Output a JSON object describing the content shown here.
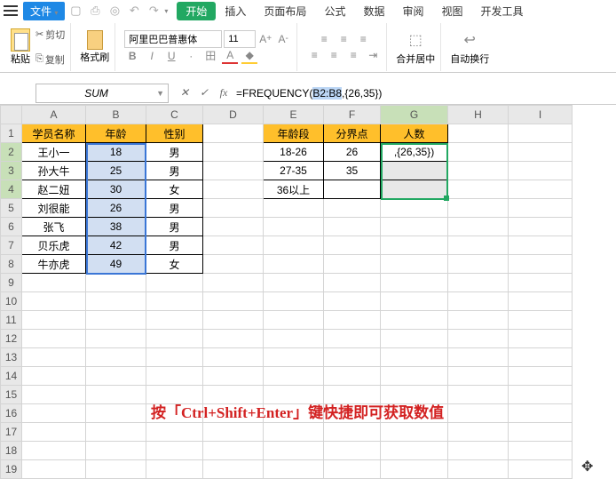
{
  "menubar": {
    "file": "文件"
  },
  "tabs": [
    "开始",
    "插入",
    "页面布局",
    "公式",
    "数据",
    "审阅",
    "视图",
    "开发工具"
  ],
  "ribbon": {
    "paste": "粘贴",
    "cut": "剪切",
    "copy": "复制",
    "fmtpaint": "格式刷",
    "font_name": "阿里巴巴普惠体",
    "font_size": "11",
    "merge": "合并居中",
    "autowrap": "自动换行"
  },
  "fbar": {
    "name": "SUM",
    "formula_pre": "=FREQUENCY(",
    "formula_hl": "B2:B8",
    "formula_post": ",{26,35})"
  },
  "cols": [
    "A",
    "B",
    "C",
    "D",
    "E",
    "F",
    "G",
    "H",
    "I"
  ],
  "rows": [
    "1",
    "2",
    "3",
    "4",
    "5",
    "6",
    "7",
    "8",
    "9",
    "10",
    "11",
    "12",
    "13",
    "14",
    "15",
    "16",
    "17",
    "18",
    "19"
  ],
  "t1": {
    "h": [
      "学员名称",
      "年龄",
      "性别"
    ],
    "r": [
      [
        "王小一",
        "18",
        "男"
      ],
      [
        "孙大牛",
        "25",
        "男"
      ],
      [
        "赵二妞",
        "30",
        "女"
      ],
      [
        "刘很能",
        "26",
        "男"
      ],
      [
        "张飞",
        "38",
        "男"
      ],
      [
        "贝乐虎",
        "42",
        "男"
      ],
      [
        "牛亦虎",
        "49",
        "女"
      ]
    ]
  },
  "t2": {
    "h": [
      "年龄段",
      "分界点",
      "人数"
    ],
    "r": [
      [
        "18-26",
        "26",
        ",{26,35})"
      ],
      [
        "27-35",
        "35",
        ""
      ],
      [
        "36以上",
        "",
        ""
      ]
    ]
  },
  "annotation": "按「Ctrl+Shift+Enter」键快捷即可获取数值"
}
